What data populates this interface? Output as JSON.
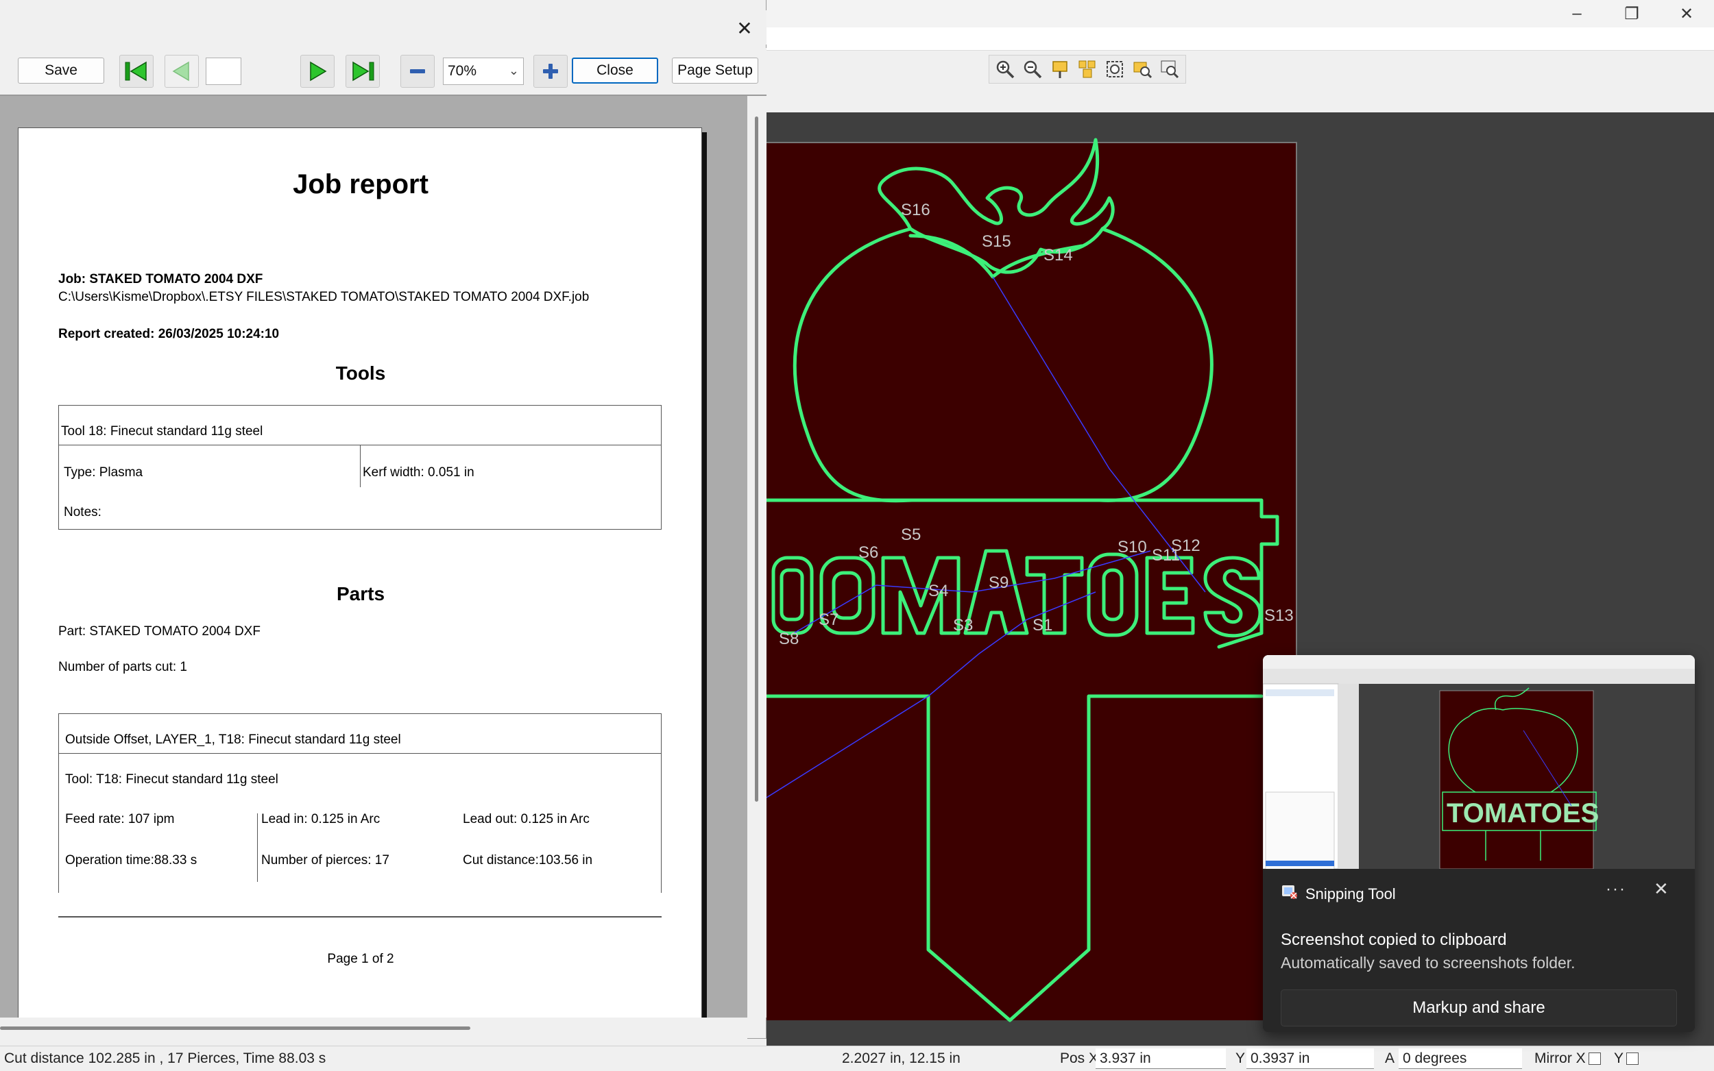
{
  "report": {
    "toolbar": {
      "save_label": "Save",
      "page_value": "",
      "zoom_value": "70%",
      "close_label": "Close",
      "page_setup_label": "Page Setup"
    },
    "title": "Job report",
    "job_line": "Job: STAKED TOMATO 2004 DXF",
    "job_path": "C:\\Users\\Kisme\\Dropbox\\.ETSY FILES\\STAKED TOMATO\\STAKED TOMATO 2004 DXF.job",
    "created_line": "Report created: 26/03/2025 10:24:10",
    "tools_heading": "Tools",
    "tool": {
      "name": "Tool 18: Finecut standard 11g steel",
      "type": "Type: Plasma",
      "kerf": "Kerf width: 0.051 in",
      "notes": "Notes:"
    },
    "parts_heading": "Parts",
    "part_line": "Part: STAKED TOMATO 2004 DXF",
    "parts_cut_line": "Number of parts cut: 1",
    "operation": {
      "header": "Outside Offset, LAYER_1, T18: Finecut standard 11g steel",
      "tool": "Tool: T18: Finecut standard 11g steel",
      "feed_rate": "Feed rate: 107 ipm",
      "lead_in": "Lead in: 0.125 in Arc",
      "lead_out": "Lead out: 0.125 in Arc",
      "op_time": "Operation time:88.33 s",
      "pierces": "Number of pierces: 17",
      "cut_distance": "Cut distance:103.56 in"
    },
    "page_footer": "Page 1 of 2"
  },
  "drawing": {
    "text": "TOMATOES",
    "labels": [
      "S16",
      "S15",
      "S14",
      "S5",
      "S6",
      "S10",
      "S12",
      "S11",
      "S4",
      "S9",
      "S7",
      "S8",
      "S3",
      "S1",
      "S13"
    ],
    "colors": {
      "workpiece": "#3c0000",
      "path": "#3df07a",
      "rapid": "#3a3aff",
      "background": "#3f3f3f"
    }
  },
  "statusbar": {
    "summary": "Cut distance 102.285 in , 17 Pierces, Time 88.03 s",
    "cursor_coords": "2.2027 in, 12.15 in",
    "pos_x_label": "Pos X",
    "pos_x_value": "3.937 in",
    "pos_y_label": "Y",
    "pos_y_value": "0.3937 in",
    "angle_label": "A",
    "angle_value": "0 degrees",
    "mirror_x_label": "Mirror X",
    "mirror_y_label": "Y"
  },
  "toast": {
    "app_name": "Snipping Tool",
    "message": "Screenshot copied to clipboard",
    "sub_message": "Automatically saved to screenshots folder.",
    "button_label": "Markup and share",
    "thumb_text": "TOMATOES"
  }
}
